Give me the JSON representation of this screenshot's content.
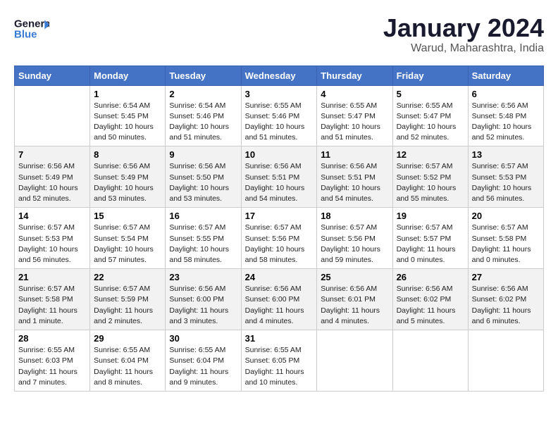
{
  "header": {
    "logo_line1": "General",
    "logo_line2": "Blue",
    "month": "January 2024",
    "location": "Warud, Maharashtra, India"
  },
  "weekdays": [
    "Sunday",
    "Monday",
    "Tuesday",
    "Wednesday",
    "Thursday",
    "Friday",
    "Saturday"
  ],
  "weeks": [
    [
      {
        "day": "",
        "info": ""
      },
      {
        "day": "1",
        "info": "Sunrise: 6:54 AM\nSunset: 5:45 PM\nDaylight: 10 hours\nand 50 minutes."
      },
      {
        "day": "2",
        "info": "Sunrise: 6:54 AM\nSunset: 5:46 PM\nDaylight: 10 hours\nand 51 minutes."
      },
      {
        "day": "3",
        "info": "Sunrise: 6:55 AM\nSunset: 5:46 PM\nDaylight: 10 hours\nand 51 minutes."
      },
      {
        "day": "4",
        "info": "Sunrise: 6:55 AM\nSunset: 5:47 PM\nDaylight: 10 hours\nand 51 minutes."
      },
      {
        "day": "5",
        "info": "Sunrise: 6:55 AM\nSunset: 5:47 PM\nDaylight: 10 hours\nand 52 minutes."
      },
      {
        "day": "6",
        "info": "Sunrise: 6:56 AM\nSunset: 5:48 PM\nDaylight: 10 hours\nand 52 minutes."
      }
    ],
    [
      {
        "day": "7",
        "info": "Sunrise: 6:56 AM\nSunset: 5:49 PM\nDaylight: 10 hours\nand 52 minutes."
      },
      {
        "day": "8",
        "info": "Sunrise: 6:56 AM\nSunset: 5:49 PM\nDaylight: 10 hours\nand 53 minutes."
      },
      {
        "day": "9",
        "info": "Sunrise: 6:56 AM\nSunset: 5:50 PM\nDaylight: 10 hours\nand 53 minutes."
      },
      {
        "day": "10",
        "info": "Sunrise: 6:56 AM\nSunset: 5:51 PM\nDaylight: 10 hours\nand 54 minutes."
      },
      {
        "day": "11",
        "info": "Sunrise: 6:56 AM\nSunset: 5:51 PM\nDaylight: 10 hours\nand 54 minutes."
      },
      {
        "day": "12",
        "info": "Sunrise: 6:57 AM\nSunset: 5:52 PM\nDaylight: 10 hours\nand 55 minutes."
      },
      {
        "day": "13",
        "info": "Sunrise: 6:57 AM\nSunset: 5:53 PM\nDaylight: 10 hours\nand 56 minutes."
      }
    ],
    [
      {
        "day": "14",
        "info": "Sunrise: 6:57 AM\nSunset: 5:53 PM\nDaylight: 10 hours\nand 56 minutes."
      },
      {
        "day": "15",
        "info": "Sunrise: 6:57 AM\nSunset: 5:54 PM\nDaylight: 10 hours\nand 57 minutes."
      },
      {
        "day": "16",
        "info": "Sunrise: 6:57 AM\nSunset: 5:55 PM\nDaylight: 10 hours\nand 58 minutes."
      },
      {
        "day": "17",
        "info": "Sunrise: 6:57 AM\nSunset: 5:56 PM\nDaylight: 10 hours\nand 58 minutes."
      },
      {
        "day": "18",
        "info": "Sunrise: 6:57 AM\nSunset: 5:56 PM\nDaylight: 10 hours\nand 59 minutes."
      },
      {
        "day": "19",
        "info": "Sunrise: 6:57 AM\nSunset: 5:57 PM\nDaylight: 11 hours\nand 0 minutes."
      },
      {
        "day": "20",
        "info": "Sunrise: 6:57 AM\nSunset: 5:58 PM\nDaylight: 11 hours\nand 0 minutes."
      }
    ],
    [
      {
        "day": "21",
        "info": "Sunrise: 6:57 AM\nSunset: 5:58 PM\nDaylight: 11 hours\nand 1 minute."
      },
      {
        "day": "22",
        "info": "Sunrise: 6:57 AM\nSunset: 5:59 PM\nDaylight: 11 hours\nand 2 minutes."
      },
      {
        "day": "23",
        "info": "Sunrise: 6:56 AM\nSunset: 6:00 PM\nDaylight: 11 hours\nand 3 minutes."
      },
      {
        "day": "24",
        "info": "Sunrise: 6:56 AM\nSunset: 6:00 PM\nDaylight: 11 hours\nand 4 minutes."
      },
      {
        "day": "25",
        "info": "Sunrise: 6:56 AM\nSunset: 6:01 PM\nDaylight: 11 hours\nand 4 minutes."
      },
      {
        "day": "26",
        "info": "Sunrise: 6:56 AM\nSunset: 6:02 PM\nDaylight: 11 hours\nand 5 minutes."
      },
      {
        "day": "27",
        "info": "Sunrise: 6:56 AM\nSunset: 6:02 PM\nDaylight: 11 hours\nand 6 minutes."
      }
    ],
    [
      {
        "day": "28",
        "info": "Sunrise: 6:55 AM\nSunset: 6:03 PM\nDaylight: 11 hours\nand 7 minutes."
      },
      {
        "day": "29",
        "info": "Sunrise: 6:55 AM\nSunset: 6:04 PM\nDaylight: 11 hours\nand 8 minutes."
      },
      {
        "day": "30",
        "info": "Sunrise: 6:55 AM\nSunset: 6:04 PM\nDaylight: 11 hours\nand 9 minutes."
      },
      {
        "day": "31",
        "info": "Sunrise: 6:55 AM\nSunset: 6:05 PM\nDaylight: 11 hours\nand 10 minutes."
      },
      {
        "day": "",
        "info": ""
      },
      {
        "day": "",
        "info": ""
      },
      {
        "day": "",
        "info": ""
      }
    ]
  ]
}
